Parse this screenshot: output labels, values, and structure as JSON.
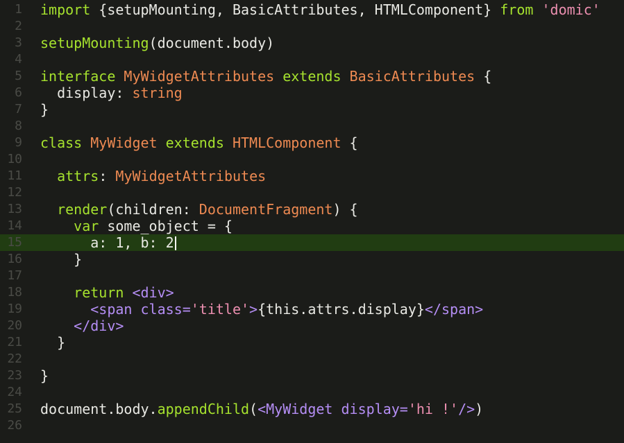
{
  "theme": {
    "background": "#1b1c19",
    "current_line": "#213d12",
    "gutter_text": "#4a4b46",
    "keyword": "#a6e22e",
    "type": "#ee8a52",
    "string": "#ec8fb0",
    "tag": "#b58ef5",
    "plain": "#e9e9e4"
  },
  "cursor": {
    "line": 15
  },
  "lines": [
    {
      "n": "1",
      "tokens": [
        [
          "keyword",
          "import "
        ],
        [
          "plain",
          "{setupMounting, BasicAttributes, HTMLComponent} "
        ],
        [
          "keyword",
          "from "
        ],
        [
          "string",
          "'domic'"
        ]
      ]
    },
    {
      "n": "2",
      "tokens": []
    },
    {
      "n": "3",
      "tokens": [
        [
          "func",
          "setupMounting"
        ],
        [
          "plain",
          "(document.body)"
        ]
      ]
    },
    {
      "n": "4",
      "tokens": []
    },
    {
      "n": "5",
      "tokens": [
        [
          "keyword",
          "interface "
        ],
        [
          "type",
          "MyWidgetAttributes "
        ],
        [
          "keyword",
          "extends "
        ],
        [
          "type",
          "BasicAttributes "
        ],
        [
          "plain",
          "{"
        ]
      ]
    },
    {
      "n": "6",
      "tokens": [
        [
          "plain",
          "  display: "
        ],
        [
          "type",
          "string"
        ]
      ]
    },
    {
      "n": "7",
      "tokens": [
        [
          "plain",
          "}"
        ]
      ]
    },
    {
      "n": "8",
      "tokens": []
    },
    {
      "n": "9",
      "tokens": [
        [
          "keyword",
          "class "
        ],
        [
          "type",
          "MyWidget "
        ],
        [
          "keyword",
          "extends "
        ],
        [
          "type",
          "HTMLComponent "
        ],
        [
          "plain",
          "{"
        ]
      ]
    },
    {
      "n": "10",
      "tokens": []
    },
    {
      "n": "11",
      "tokens": [
        [
          "plain",
          "  "
        ],
        [
          "keyword",
          "attrs"
        ],
        [
          "plain",
          ": "
        ],
        [
          "type",
          "MyWidgetAttributes"
        ]
      ]
    },
    {
      "n": "12",
      "tokens": []
    },
    {
      "n": "13",
      "tokens": [
        [
          "plain",
          "  "
        ],
        [
          "func",
          "render"
        ],
        [
          "plain",
          "(children: "
        ],
        [
          "type",
          "DocumentFragment"
        ],
        [
          "plain",
          ") {"
        ]
      ]
    },
    {
      "n": "14",
      "tokens": [
        [
          "plain",
          "    "
        ],
        [
          "keyword",
          "var "
        ],
        [
          "plain",
          "some_object = {"
        ]
      ]
    },
    {
      "n": "15",
      "tokens": [
        [
          "plain",
          "      a: 1, b: 2"
        ]
      ]
    },
    {
      "n": "16",
      "tokens": [
        [
          "plain",
          "    }"
        ]
      ]
    },
    {
      "n": "17",
      "tokens": []
    },
    {
      "n": "18",
      "tokens": [
        [
          "plain",
          "    "
        ],
        [
          "keyword",
          "return "
        ],
        [
          "tag",
          "<div>"
        ]
      ]
    },
    {
      "n": "19",
      "tokens": [
        [
          "plain",
          "      "
        ],
        [
          "tag",
          "<span "
        ],
        [
          "attr",
          "class="
        ],
        [
          "string",
          "'title'"
        ],
        [
          "tag",
          ">"
        ],
        [
          "plain",
          "{this.attrs.display}"
        ],
        [
          "tag",
          "</span>"
        ]
      ]
    },
    {
      "n": "20",
      "tokens": [
        [
          "plain",
          "    "
        ],
        [
          "tag",
          "</div>"
        ]
      ]
    },
    {
      "n": "21",
      "tokens": [
        [
          "plain",
          "  }"
        ]
      ]
    },
    {
      "n": "22",
      "tokens": []
    },
    {
      "n": "23",
      "tokens": [
        [
          "plain",
          "}"
        ]
      ]
    },
    {
      "n": "24",
      "tokens": []
    },
    {
      "n": "25",
      "tokens": [
        [
          "plain",
          "document.body."
        ],
        [
          "func",
          "appendChild"
        ],
        [
          "plain",
          "("
        ],
        [
          "tag",
          "<MyWidget "
        ],
        [
          "attr",
          "display="
        ],
        [
          "string",
          "'hi !'"
        ],
        [
          "tag",
          "/>"
        ],
        [
          "plain",
          ")"
        ]
      ]
    },
    {
      "n": "26",
      "tokens": []
    }
  ]
}
